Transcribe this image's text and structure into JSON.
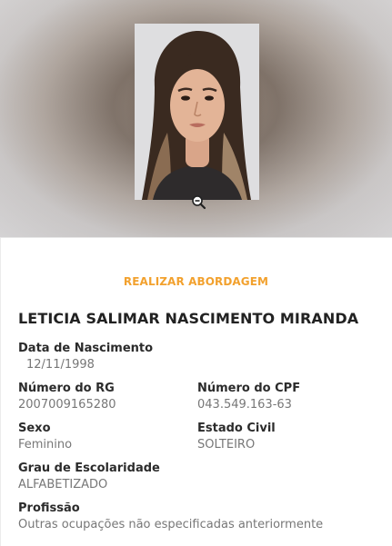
{
  "action": {
    "label": "REALIZAR ABORDAGEM"
  },
  "person": {
    "name": "LETICIA SALIMAR NASCIMENTO MIRANDA",
    "birth": {
      "label": "Data de Nascimento",
      "value": "12/11/1998"
    },
    "rg": {
      "label": "Número do RG",
      "value": "2007009165280"
    },
    "cpf": {
      "label": "Número do CPF",
      "value": "043.549.163-63"
    },
    "sex": {
      "label": "Sexo",
      "value": "Feminino"
    },
    "civil": {
      "label": "Estado Civil",
      "value": "SOLTEIRO"
    },
    "education": {
      "label": "Grau de Escolaridade",
      "value": "ALFABETIZADO"
    },
    "profession": {
      "label": "Profissão",
      "value": "Outras ocupações não especificadas anteriormente"
    }
  },
  "icons": {
    "zoom": "zoom-out-icon"
  },
  "colors": {
    "accent": "#f2a12e",
    "label": "#2b2b2b",
    "value": "#777777"
  }
}
